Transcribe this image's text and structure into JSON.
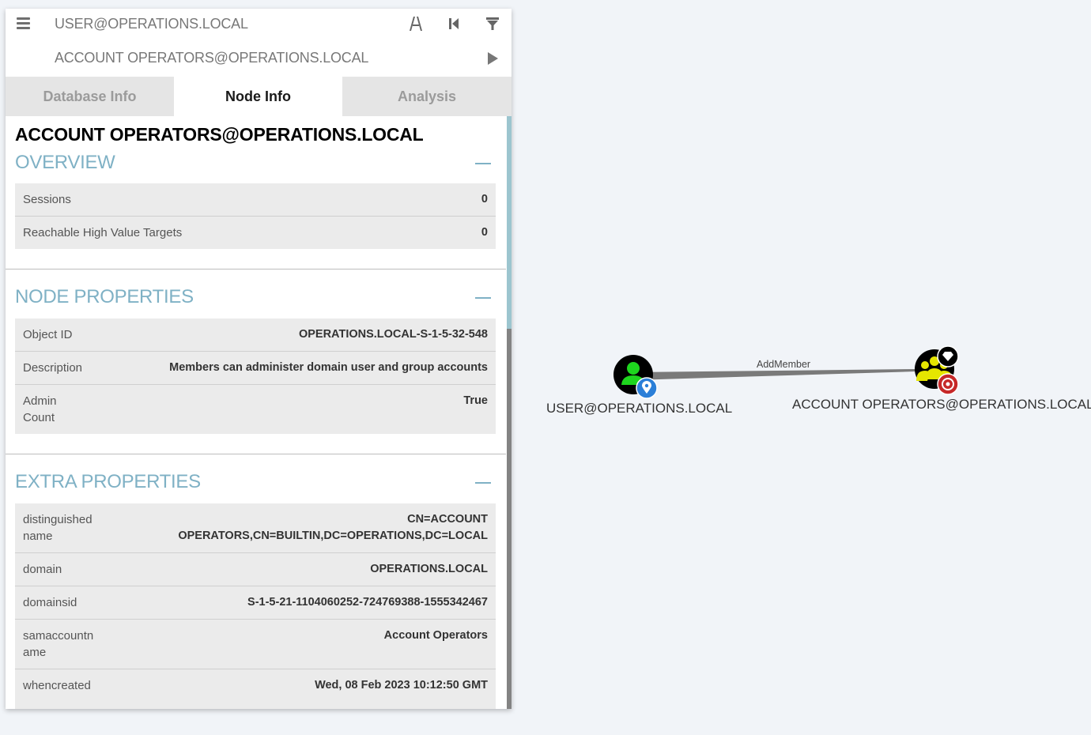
{
  "search": {
    "start": "USER@OPERATIONS.LOCAL",
    "target": "ACCOUNT OPERATORS@OPERATIONS.LOCAL"
  },
  "tabs": [
    {
      "label": "Database Info"
    },
    {
      "label": "Node Info"
    },
    {
      "label": "Analysis"
    }
  ],
  "node": {
    "title": "ACCOUNT OPERATORS@OPERATIONS.LOCAL",
    "overview": {
      "heading": "OVERVIEW",
      "rows": [
        {
          "key": "Sessions",
          "value": "0"
        },
        {
          "key": "Reachable High Value Targets",
          "value": "0"
        }
      ]
    },
    "node_properties": {
      "heading": "NODE PROPERTIES",
      "rows": [
        {
          "key": "Object ID",
          "value": "OPERATIONS.LOCAL-S-1-5-32-548"
        },
        {
          "key": "Description",
          "value": "Members can administer domain user and group accounts"
        },
        {
          "key": "Admin Count",
          "value": "True"
        }
      ]
    },
    "extra_properties": {
      "heading": "EXTRA PROPERTIES",
      "rows": [
        {
          "key": "distinguishedname",
          "value": "CN=ACCOUNT OPERATORS,CN=BUILTIN,DC=OPERATIONS,DC=LOCAL"
        },
        {
          "key": "domain",
          "value": "OPERATIONS.LOCAL"
        },
        {
          "key": "domainsid",
          "value": "S-1-5-21-1104060252-724769388-1555342467"
        },
        {
          "key": "samaccountname",
          "value": "Account Operators"
        },
        {
          "key": "whencreated",
          "value": "Wed, 08 Feb 2023 10:12:50 GMT"
        }
      ]
    }
  },
  "graph": {
    "source_label": "USER@OPERATIONS.LOCAL",
    "target_label": "ACCOUNT OPERATORS@OPERATIONS.LOCAL",
    "edge_label": "AddMember",
    "colors": {
      "user_node": "#1ed61e",
      "group_node": "#e6e600",
      "owned_badge": "#2b7fd8",
      "target_badge": "#c62828",
      "edge": "#7a7a7a"
    }
  }
}
